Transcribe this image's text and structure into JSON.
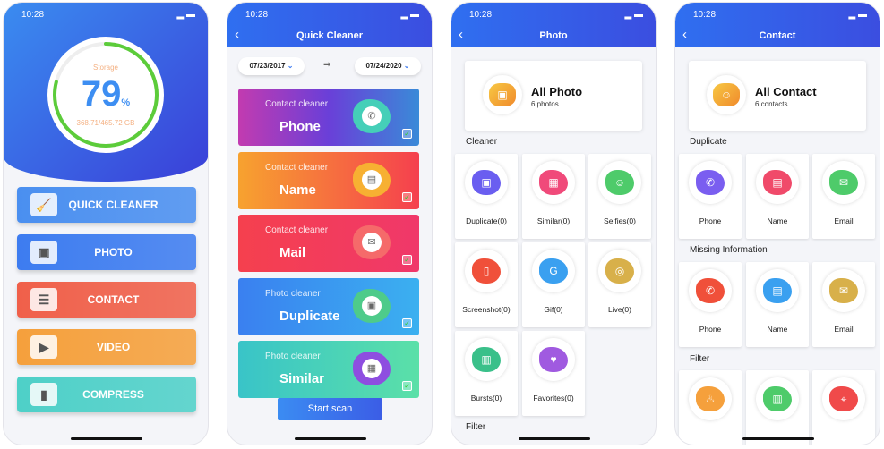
{
  "status_time": "10:28",
  "home": {
    "storage_label": "Storage",
    "percent": "79",
    "percent_sign": "%",
    "usage": "368.71/465.72 GB",
    "storage_fraction": 0.79,
    "menu": [
      {
        "label": "QUICK CLEANER",
        "icon": "broom-icon",
        "color": "#4a8ff0"
      },
      {
        "label": "PHOTO",
        "icon": "image-icon",
        "color": "#3d7cf0"
      },
      {
        "label": "CONTACT",
        "icon": "contact-book-icon",
        "color": "#f0604a"
      },
      {
        "label": "VIDEO",
        "icon": "video-camera-icon",
        "color": "#f5a03c"
      },
      {
        "label": "COMPRESS",
        "icon": "zip-icon",
        "color": "#4ed0c8"
      }
    ]
  },
  "quick": {
    "title": "Quick Cleaner",
    "date_from": "07/23/2017",
    "date_to": "07/24/2020",
    "start_label": "Start scan",
    "cards": [
      {
        "sub": "Contact cleaner",
        "title": "Phone",
        "icon": "phone-icon",
        "bg": "linear-gradient(90deg,#c23bb0,#6a3fd8,#3a8ad8)",
        "blob": "#45cfb8"
      },
      {
        "sub": "Contact cleaner",
        "title": "Name",
        "icon": "id-card-icon",
        "bg": "linear-gradient(90deg,#f7a22f,#f5404e)",
        "blob": "#f7b032"
      },
      {
        "sub": "Contact cleaner",
        "title": "Mail",
        "icon": "mail-icon",
        "bg": "linear-gradient(90deg,#f5404e,#f0386a)",
        "blob": "#f56a6a"
      },
      {
        "sub": "Photo cleaner",
        "title": "Duplicate",
        "icon": "photos-icon",
        "bg": "linear-gradient(90deg,#3a80f0,#3bb0f0)",
        "blob": "#4ecb8a"
      },
      {
        "sub": "Photo cleaner",
        "title": "Similar",
        "icon": "similar-photos-icon",
        "bg": "linear-gradient(90deg,#39c4c8,#5be0a8)",
        "blob": "#8e4ee0"
      }
    ]
  },
  "photo": {
    "title": "Photo",
    "all_title": "All Photo",
    "all_sub": "6 photos",
    "cleaner_label": "Cleaner",
    "filter_label": "Filter",
    "tiles": [
      {
        "label": "Duplicate(0)",
        "icon": "duplicate-icon",
        "color": "#6a5ef0"
      },
      {
        "label": "Similar(0)",
        "icon": "similar-icon",
        "color": "#f04a7a"
      },
      {
        "label": "Selfies(0)",
        "icon": "selfie-icon",
        "color": "#4ecb6a"
      },
      {
        "label": "Screenshot(0)",
        "icon": "screenshot-icon",
        "color": "#f0503a"
      },
      {
        "label": "Gif(0)",
        "icon": "gif-icon",
        "color": "#3aa0f0"
      },
      {
        "label": "Live(0)",
        "icon": "live-icon",
        "color": "#d8b04a"
      },
      {
        "label": "Bursts(0)",
        "icon": "bursts-icon",
        "color": "#3ac08a"
      },
      {
        "label": "Favorites(0)",
        "icon": "heart-icon",
        "color": "#a05ae0"
      }
    ]
  },
  "contact": {
    "title": "Contact",
    "all_title": "All Contact",
    "all_sub": "6 contacts",
    "duplicate_label": "Duplicate",
    "missing_label": "Missing Information",
    "filter_label": "Filter",
    "duplicate": [
      {
        "label": "Phone",
        "icon": "phone-icon",
        "color": "#7a5ef0"
      },
      {
        "label": "Name",
        "icon": "id-card-icon",
        "color": "#f04a6a"
      },
      {
        "label": "Email",
        "icon": "mail-icon",
        "color": "#4ecb6a"
      }
    ],
    "missing": [
      {
        "label": "Phone",
        "icon": "phone-icon",
        "color": "#f0503a"
      },
      {
        "label": "Name",
        "icon": "id-card-icon",
        "color": "#3aa0f0"
      },
      {
        "label": "Email",
        "icon": "mail-icon",
        "color": "#d8b04a"
      }
    ],
    "filter": [
      {
        "icon": "birthday-cake-icon",
        "color": "#f5a03c"
      },
      {
        "icon": "building-icon",
        "color": "#4ecb6a"
      },
      {
        "icon": "location-pin-icon",
        "color": "#f04a4a"
      }
    ]
  }
}
